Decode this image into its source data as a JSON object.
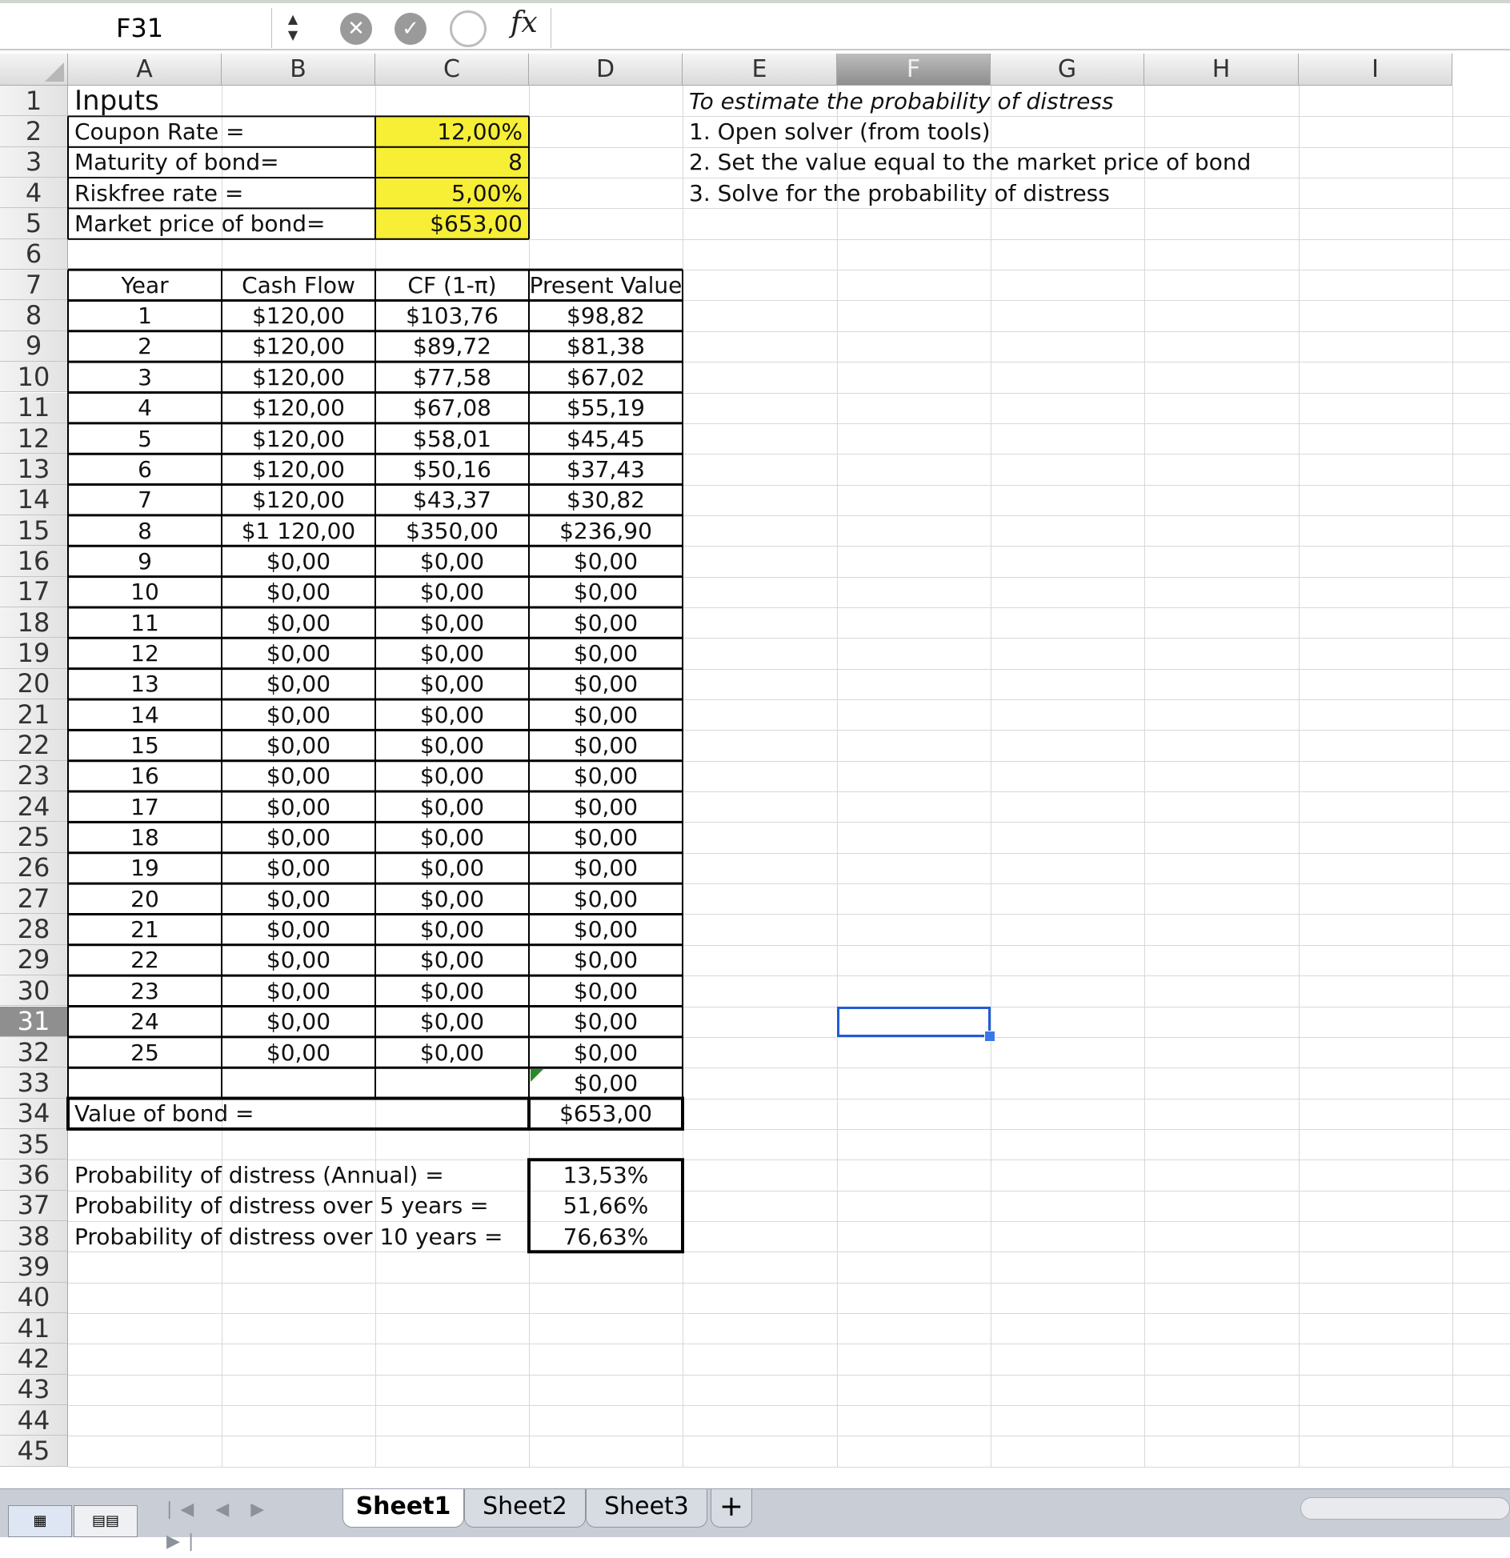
{
  "formula_bar": {
    "name_box": "F31",
    "fx_label": "fx",
    "formula": ""
  },
  "columns": [
    "A",
    "B",
    "C",
    "D",
    "E",
    "F",
    "G",
    "H",
    "I"
  ],
  "selected_column": "F",
  "selected_row": 31,
  "rows": [
    1,
    2,
    3,
    4,
    5,
    6,
    7,
    8,
    9,
    10,
    11,
    12,
    13,
    14,
    15,
    16,
    17,
    18,
    19,
    20,
    21,
    22,
    23,
    24,
    25,
    26,
    27,
    28,
    29,
    30,
    31,
    32,
    33,
    34,
    35,
    36,
    37,
    38,
    39,
    40,
    41,
    42,
    43,
    44,
    45
  ],
  "inputs": {
    "title": "Inputs",
    "coupon_label": "Coupon Rate =",
    "coupon_value": "12,00%",
    "maturity_label": "Maturity of bond=",
    "maturity_value": "8",
    "riskfree_label": "Riskfree rate =",
    "riskfree_value": "5,00%",
    "market_label": "Market price of bond=",
    "market_value": "$653,00"
  },
  "instructions": {
    "title": "To estimate the probability of distress",
    "step1": "1. Open solver (from tools)",
    "step2": "2. Set the value equal to the market price of bond",
    "step3": "3. Solve for the probability of distress"
  },
  "table": {
    "headers": [
      "Year",
      "Cash Flow",
      "CF (1-π)",
      "Present Value"
    ],
    "rows": [
      [
        "1",
        "$120,00",
        "$103,76",
        "$98,82"
      ],
      [
        "2",
        "$120,00",
        "$89,72",
        "$81,38"
      ],
      [
        "3",
        "$120,00",
        "$77,58",
        "$67,02"
      ],
      [
        "4",
        "$120,00",
        "$67,08",
        "$55,19"
      ],
      [
        "5",
        "$120,00",
        "$58,01",
        "$45,45"
      ],
      [
        "6",
        "$120,00",
        "$50,16",
        "$37,43"
      ],
      [
        "7",
        "$120,00",
        "$43,37",
        "$30,82"
      ],
      [
        "8",
        "$1 120,00",
        "$350,00",
        "$236,90"
      ],
      [
        "9",
        "$0,00",
        "$0,00",
        "$0,00"
      ],
      [
        "10",
        "$0,00",
        "$0,00",
        "$0,00"
      ],
      [
        "11",
        "$0,00",
        "$0,00",
        "$0,00"
      ],
      [
        "12",
        "$0,00",
        "$0,00",
        "$0,00"
      ],
      [
        "13",
        "$0,00",
        "$0,00",
        "$0,00"
      ],
      [
        "14",
        "$0,00",
        "$0,00",
        "$0,00"
      ],
      [
        "15",
        "$0,00",
        "$0,00",
        "$0,00"
      ],
      [
        "16",
        "$0,00",
        "$0,00",
        "$0,00"
      ],
      [
        "17",
        "$0,00",
        "$0,00",
        "$0,00"
      ],
      [
        "18",
        "$0,00",
        "$0,00",
        "$0,00"
      ],
      [
        "19",
        "$0,00",
        "$0,00",
        "$0,00"
      ],
      [
        "20",
        "$0,00",
        "$0,00",
        "$0,00"
      ],
      [
        "21",
        "$0,00",
        "$0,00",
        "$0,00"
      ],
      [
        "22",
        "$0,00",
        "$0,00",
        "$0,00"
      ],
      [
        "23",
        "$0,00",
        "$0,00",
        "$0,00"
      ],
      [
        "24",
        "$0,00",
        "$0,00",
        "$0,00"
      ],
      [
        "25",
        "$0,00",
        "$0,00",
        "$0,00"
      ],
      [
        "",
        "",
        "",
        "$0,00"
      ]
    ]
  },
  "value_of_bond": {
    "label": "Value of bond =",
    "value": "$653,00"
  },
  "probabilities": [
    {
      "label": "Probability of distress (Annual) =",
      "value": "13,53%"
    },
    {
      "label": "Probability of distress over 5 years =",
      "value": "51,66%"
    },
    {
      "label": "Probability of distress over 10 years =",
      "value": "76,63%"
    }
  ],
  "sheets": [
    "Sheet1",
    "Sheet2",
    "Sheet3"
  ],
  "active_sheet": "Sheet1",
  "add_sheet_label": "+",
  "icons": {
    "cancel": "x-circle-icon",
    "confirm": "check-circle-icon",
    "insert_function": "function-circle-icon"
  }
}
